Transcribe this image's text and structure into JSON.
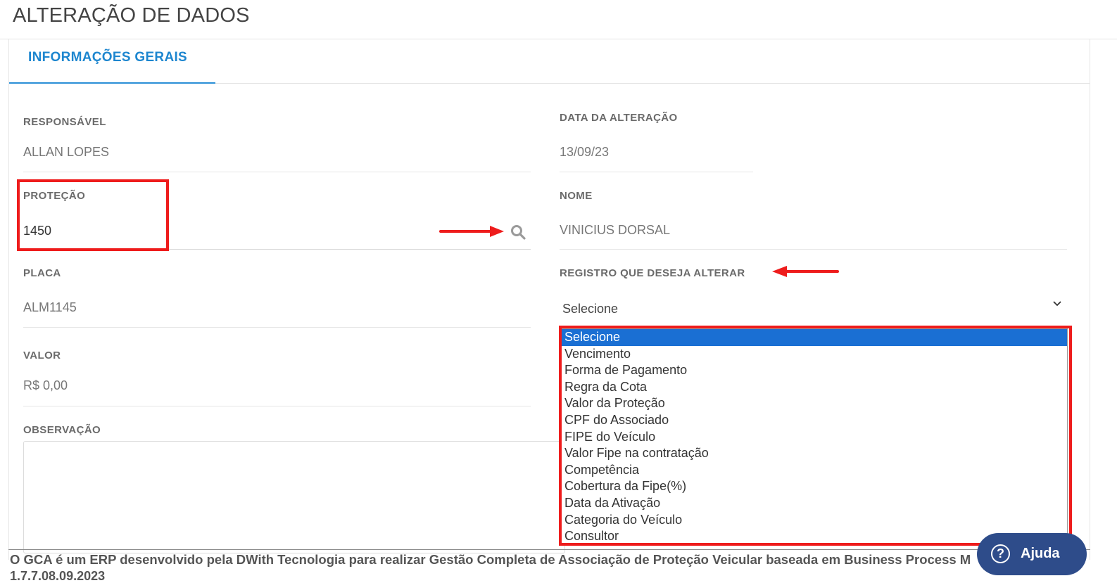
{
  "page": {
    "title": "ALTERAÇÃO DE DADOS"
  },
  "tabs": [
    {
      "label": "INFORMAÇÕES GERAIS",
      "active": true
    }
  ],
  "form": {
    "responsavel": {
      "label": "RESPONSÁVEL",
      "value": "ALLAN LOPES"
    },
    "data_alteracao": {
      "label": "DATA DA ALTERAÇÃO",
      "value": "13/09/23"
    },
    "protecao": {
      "label": "PROTEÇÃO",
      "value": "1450"
    },
    "nome": {
      "label": "NOME",
      "value": "VINICIUS DORSAL"
    },
    "placa": {
      "label": "PLACA",
      "value": "ALM1145"
    },
    "registro": {
      "label": "REGISTRO QUE DESEJA ALTERAR",
      "value": "Selecione"
    },
    "valor": {
      "label": "VALOR",
      "value": "R$ 0,00"
    },
    "observacao": {
      "label": "OBSERVAÇÃO",
      "value": ""
    }
  },
  "dropdown": {
    "selected_index": 0,
    "options": [
      "Selecione",
      "Vencimento",
      "Forma de Pagamento",
      "Regra da Cota",
      "Valor da Proteção",
      "CPF do Associado",
      "FIPE do Veículo",
      "Valor Fipe na contratação",
      "Competência",
      "Cobertura da Fipe(%)",
      "Data da Ativação",
      "Categoria do Veículo",
      "Consultor"
    ]
  },
  "footer": {
    "text": "O GCA é um ERP desenvolvido pela DWith Tecnologia para realizar Gestão Completa de Associação de Proteção Veicular baseada em Business Process M",
    "version": "1.7.7.08.09.2023"
  },
  "help_button": {
    "label": "Ajuda",
    "icon": "question-circle-icon"
  },
  "colors": {
    "accent": "#1d86cf",
    "annotation": "#ee1c1c",
    "selected_option": "#1a6fd3",
    "help": "#2e4c8a"
  }
}
